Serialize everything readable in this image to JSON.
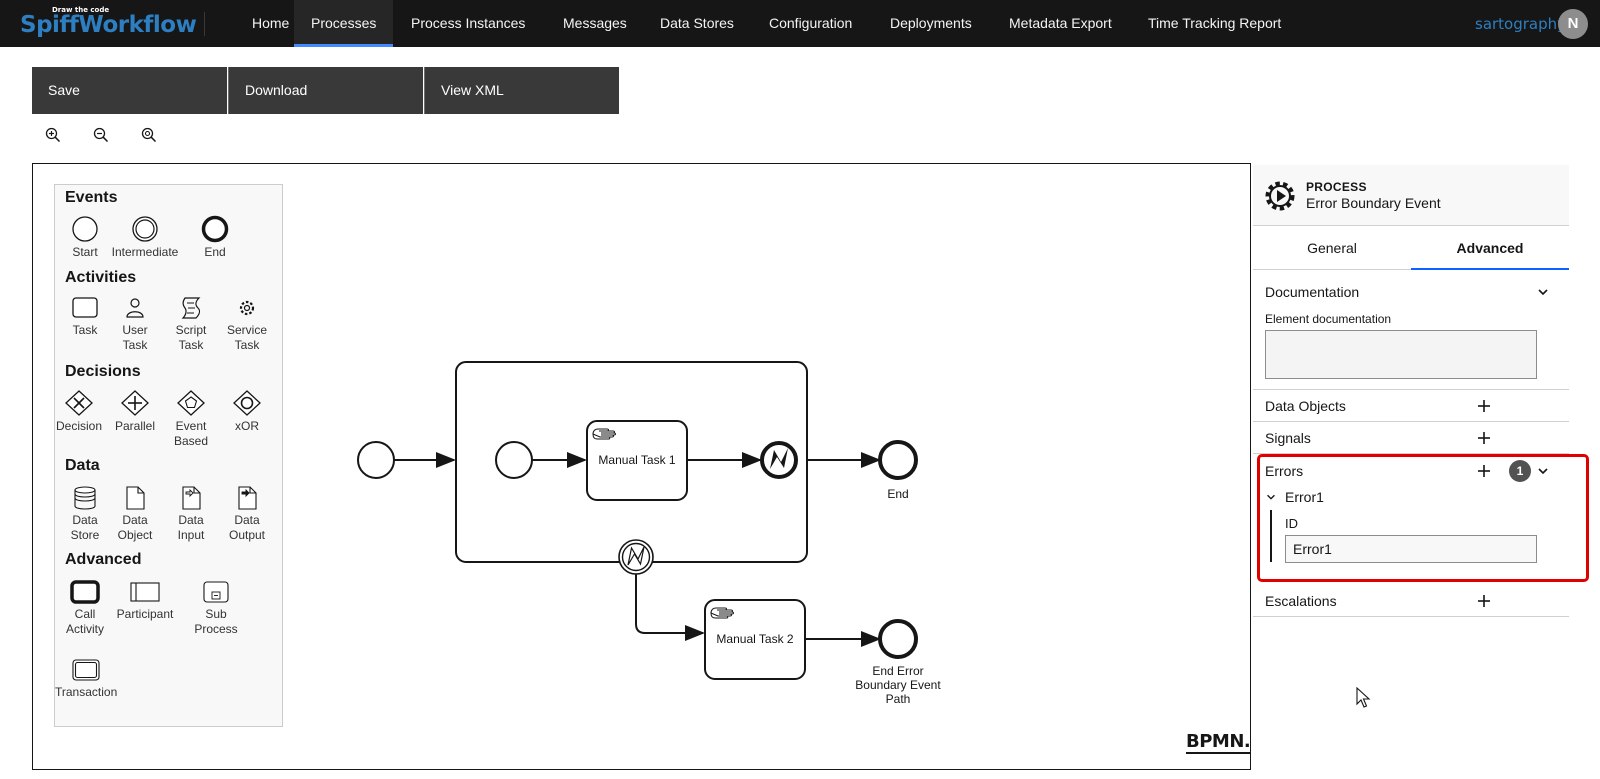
{
  "app": {
    "logo_tagline": "Draw the code",
    "logo_name": "SpiffWorkflow"
  },
  "nav": {
    "items": [
      {
        "label": "Home"
      },
      {
        "label": "Processes"
      },
      {
        "label": "Process Instances"
      },
      {
        "label": "Messages"
      },
      {
        "label": "Data Stores"
      },
      {
        "label": "Configuration"
      },
      {
        "label": "Deployments"
      },
      {
        "label": "Metadata Export"
      },
      {
        "label": "Time Tracking Report"
      }
    ],
    "active": "Processes",
    "user": "sartography",
    "avatar_initial": "N"
  },
  "toolbar": {
    "save_label": "Save",
    "download_label": "Download",
    "view_xml_label": "View XML"
  },
  "zoom": {
    "zoom_in_icon": "zoom-in-icon",
    "zoom_out_icon": "zoom-out-icon",
    "zoom_fit_icon": "zoom-fit-icon"
  },
  "palette": {
    "groups": {
      "events": "Events",
      "activities": "Activities",
      "decisions": "Decisions",
      "data": "Data",
      "advanced": "Advanced"
    },
    "events": [
      "Start",
      "Intermediate",
      "End"
    ],
    "activities": [
      "Task",
      "User\nTask",
      "Script\nTask",
      "Service\nTask"
    ],
    "decisions": [
      "Decision",
      "Parallel",
      "Event\nBased",
      "xOR"
    ],
    "data": [
      "Data\nStore",
      "Data\nObject",
      "Data\nInput",
      "Data\nOutput"
    ],
    "advanced": [
      "Call\nActivity",
      "Participant",
      "Sub\nProcess",
      "Transaction"
    ]
  },
  "diagram": {
    "task1": "Manual Task 1",
    "task2": "Manual Task 2",
    "end1": "End",
    "end2": "End Error\nBoundary Event\nPath",
    "watermark": "BPMN.io"
  },
  "properties": {
    "type": "PROCESS",
    "name": "Error Boundary Event",
    "tabs": [
      "General",
      "Advanced"
    ],
    "active_tab": "Advanced",
    "documentation": {
      "title": "Documentation",
      "field_label": "Element documentation",
      "value": ""
    },
    "data_objects": "Data Objects",
    "signals": "Signals",
    "errors": {
      "title": "Errors",
      "count": "1",
      "item_name": "Error1",
      "id_label": "ID",
      "id_value": "Error1"
    },
    "escalations": "Escalations"
  },
  "colors": {
    "nav_bg": "#161616",
    "accent": "#0f62fe",
    "highlight": "#e00000",
    "logo": "#2e7fc1"
  }
}
